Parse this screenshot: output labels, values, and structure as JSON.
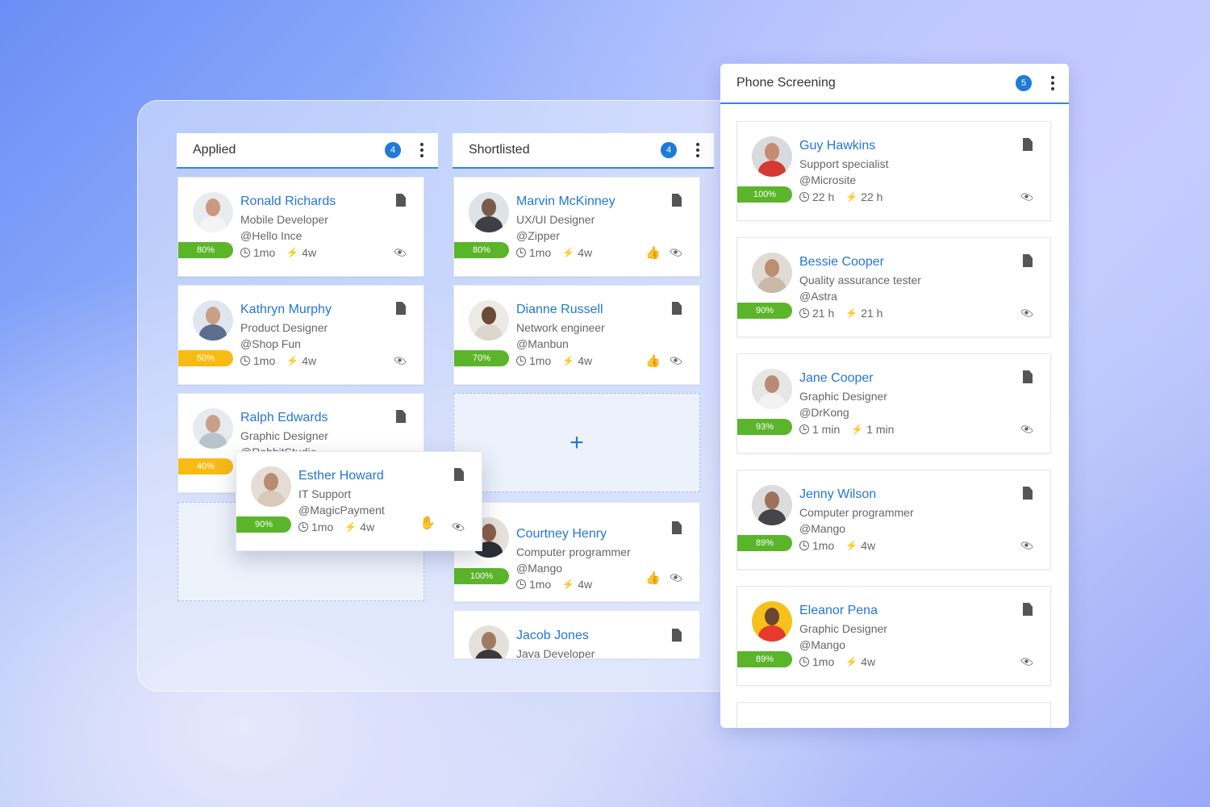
{
  "columns": {
    "applied": {
      "title": "Applied",
      "count": "4"
    },
    "shortlisted": {
      "title": "Shortlisted",
      "count": "4"
    },
    "phone": {
      "title": "Phone Screening",
      "count": "5"
    }
  },
  "applied_cards": [
    {
      "name": "Ronald Richards",
      "role": "Mobile Developer",
      "company": "@Hello Ince",
      "age": "1mo",
      "activity": "4w",
      "score": "80%",
      "score_color": "#5ab52a"
    },
    {
      "name": "Kathryn Murphy",
      "role": "Product Designer",
      "company": "@Shop Fun",
      "age": "1mo",
      "activity": "4w",
      "score": "50%",
      "score_color": "#f8bb14"
    },
    {
      "name": "Ralph Edwards",
      "role": "Graphic Designer",
      "company": "@RabbitStudio",
      "score": "40%",
      "score_color": "#f8bb14"
    }
  ],
  "dragging_card": {
    "name": "Esther Howard",
    "role": "IT Support",
    "company": "@MagicPayment",
    "age": "1mo",
    "activity": "4w",
    "score": "90%",
    "score_color": "#5ab52a"
  },
  "shortlisted_cards": [
    {
      "name": "Marvin McKinney",
      "role": "UX/UI Designer",
      "company": "@Zipper",
      "age": "1mo",
      "activity": "4w",
      "score": "80%",
      "score_color": "#5ab52a"
    },
    {
      "name": "Dianne Russell",
      "role": "Network engineer",
      "company": "@Manbun",
      "age": "1mo",
      "activity": "4w",
      "score": "70%",
      "score_color": "#5ab52a"
    },
    {
      "name": "Courtney Henry",
      "role": "Computer programmer",
      "company": "@Mango",
      "age": "1mo",
      "activity": "4w",
      "score": "100%",
      "score_color": "#5ab52a"
    },
    {
      "name": "Jacob Jones",
      "role": "Java Developer"
    }
  ],
  "phone_cards": [
    {
      "name": "Guy Hawkins",
      "role": "Support specialist",
      "company": "@Microsite",
      "age": "22 h",
      "activity": "22 h",
      "score": "100%",
      "score_color": "#5ab52a"
    },
    {
      "name": "Bessie Cooper",
      "role": "Quality assurance tester",
      "company": "@Astra",
      "age": "21 h",
      "activity": "21 h",
      "score": "90%",
      "score_color": "#5ab52a"
    },
    {
      "name": "Jane Cooper",
      "role": "Graphic Designer",
      "company": "@DrKong",
      "age": "1 min",
      "activity": "1 min",
      "score": "93%",
      "score_color": "#5ab52a"
    },
    {
      "name": "Jenny Wilson",
      "role": "Computer programmer",
      "company": "@Mango",
      "age": "1mo",
      "activity": "4w",
      "score": "89%",
      "score_color": "#5ab52a"
    },
    {
      "name": "Eleanor Pena",
      "role": "Graphic Designer",
      "company": "@Mango",
      "age": "1mo",
      "activity": "4w",
      "score": "89%",
      "score_color": "#5ab52a"
    }
  ],
  "dropzone": {
    "plus": "+"
  },
  "icons": {
    "clock": "clock-icon",
    "activity": "bolt-icon",
    "document": "document-icon",
    "view": "eye-icon",
    "reaction": "thumbs-icon",
    "grab": "grab-hand-icon"
  },
  "colors": {
    "accent": "#1f7ad8",
    "link": "#2477d4",
    "good": "#5ab52a",
    "warn": "#f8bb14"
  }
}
